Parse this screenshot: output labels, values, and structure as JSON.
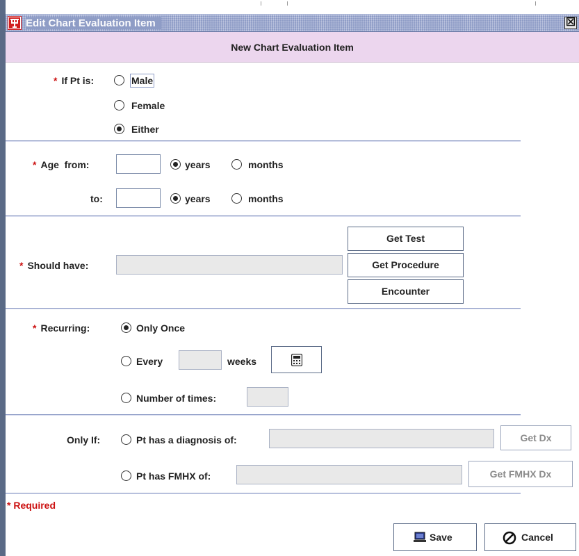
{
  "window": {
    "title": "Edit Chart Evaluation Item",
    "close_glyph": "☒"
  },
  "header": {
    "title": "New Chart Evaluation Item"
  },
  "required_mark": "*",
  "sex": {
    "label": "If Pt is:",
    "options": [
      {
        "label": "Male",
        "selected": false
      },
      {
        "label": "Female",
        "selected": false
      },
      {
        "label": "Either",
        "selected": true
      }
    ]
  },
  "age": {
    "from_label": "Age  from:",
    "to_label": "to:",
    "from_value": "",
    "to_value": "",
    "unit_years": "years",
    "unit_months": "months",
    "from_unit": "years",
    "to_unit": "years"
  },
  "should_have": {
    "label": "Should have:",
    "value": "",
    "buttons": {
      "get_test": "Get Test",
      "get_procedure": "Get Procedure",
      "encounter": "Encounter"
    }
  },
  "recurring": {
    "label": "Recurring:",
    "only_once": "Only Once",
    "every": "Every",
    "weeks": "weeks",
    "every_value": "",
    "number_of_times": "Number of times:",
    "number_value": "",
    "selected": "Only Once",
    "calculator_icon": "calculator-icon"
  },
  "only_if": {
    "label": "Only If:",
    "diagnosis_label": "Pt has a diagnosis of:",
    "diagnosis_value": "",
    "get_dx": "Get Dx",
    "fmhx_label": "Pt has FMHX of:",
    "fmhx_value": "",
    "get_fmhx_dx": "Get FMHX Dx"
  },
  "footer": {
    "required_note": "* Required",
    "save": "Save",
    "cancel": "Cancel",
    "save_icon": "laptop-icon",
    "cancel_icon": "no-entry-icon"
  },
  "colors": {
    "accent": "#8e9cc6",
    "header_bg": "#ecd6ee",
    "required": "#cc1111"
  }
}
